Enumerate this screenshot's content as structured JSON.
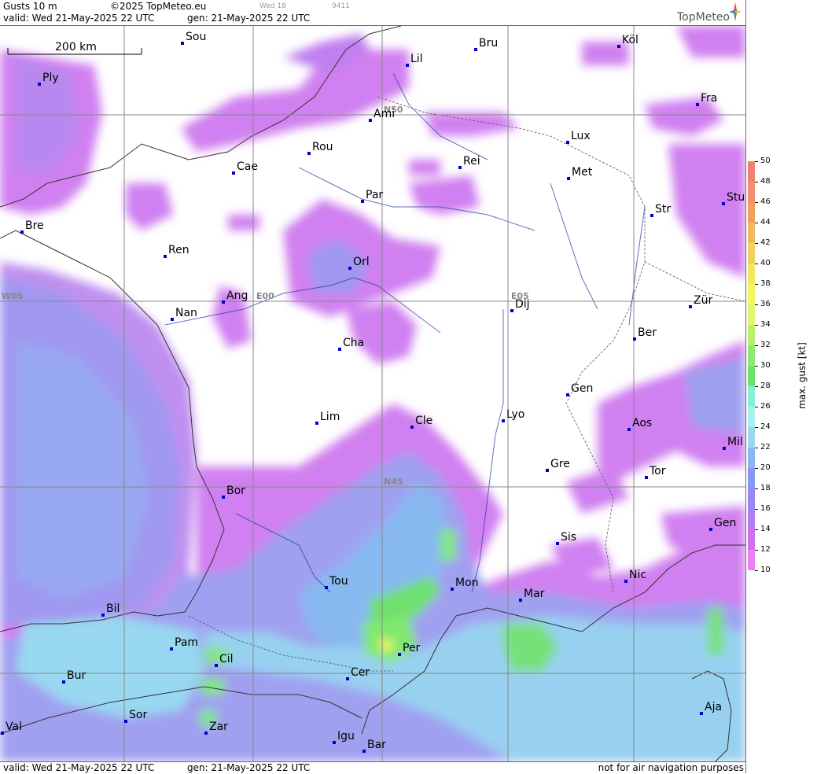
{
  "header": {
    "title": "Gusts 10 m",
    "copyright": "©2025 TopMeteo.eu",
    "valid": "valid:  Wed  21-May-2025  22 UTC",
    "gen": "gen:  21-May-2025  22 UTC",
    "small1": "Wed 18",
    "small2": "9411",
    "logo": "TopMeteo"
  },
  "footer": {
    "valid": "valid:  Wed  21-May-2025  22 UTC",
    "gen": "gen:  21-May-2025  22 UTC",
    "notice": "not for air navigation purposes"
  },
  "scale_bar": "200 km",
  "grid_labels": [
    "N50",
    "N45",
    "W05",
    "E00",
    "E05"
  ],
  "cities": [
    {
      "name": "Sou"
    },
    {
      "name": "Bru"
    },
    {
      "name": "Köl"
    },
    {
      "name": "Ply"
    },
    {
      "name": "Lil"
    },
    {
      "name": "Ami"
    },
    {
      "name": "Fra"
    },
    {
      "name": "Lux"
    },
    {
      "name": "Rou"
    },
    {
      "name": "Cae"
    },
    {
      "name": "Rei"
    },
    {
      "name": "Met"
    },
    {
      "name": "Par"
    },
    {
      "name": "Stu"
    },
    {
      "name": "Bre"
    },
    {
      "name": "Str"
    },
    {
      "name": "Ren"
    },
    {
      "name": "Orl"
    },
    {
      "name": "Ang"
    },
    {
      "name": "Nan"
    },
    {
      "name": "Dij"
    },
    {
      "name": "Zür"
    },
    {
      "name": "Cha"
    },
    {
      "name": "Ber"
    },
    {
      "name": "Gen"
    },
    {
      "name": "Lim"
    },
    {
      "name": "Cle"
    },
    {
      "name": "Lyo"
    },
    {
      "name": "Aos"
    },
    {
      "name": "Mil"
    },
    {
      "name": "Gre"
    },
    {
      "name": "Tor"
    },
    {
      "name": "Bor"
    },
    {
      "name": "Gen"
    },
    {
      "name": "Sis"
    },
    {
      "name": "Tou"
    },
    {
      "name": "Mon"
    },
    {
      "name": "Nic"
    },
    {
      "name": "Mar"
    },
    {
      "name": "Bil"
    },
    {
      "name": "Pam"
    },
    {
      "name": "Cil"
    },
    {
      "name": "Per"
    },
    {
      "name": "Cer"
    },
    {
      "name": "Bur"
    },
    {
      "name": "Sor"
    },
    {
      "name": "Aja"
    },
    {
      "name": "Val"
    },
    {
      "name": "Zar"
    },
    {
      "name": "Igu"
    },
    {
      "name": "Bar"
    }
  ],
  "legend": {
    "title": "max. gust  [kt]",
    "ticks": [
      "50",
      "48",
      "46",
      "44",
      "42",
      "40",
      "38",
      "36",
      "34",
      "32",
      "30",
      "28",
      "26",
      "24",
      "22",
      "20",
      "18",
      "16",
      "14",
      "12",
      "10"
    ],
    "colors": [
      "#f08070",
      "#f09070",
      "#f0a060",
      "#f0b860",
      "#f0d060",
      "#f0e860",
      "#f0f860",
      "#e0f870",
      "#b8f070",
      "#90e870",
      "#70e070",
      "#88f0d0",
      "#a8f0f0",
      "#98d8f0",
      "#88b8f0",
      "#8898f0",
      "#9888f0",
      "#b080f0",
      "#d070f0",
      "#e880f0"
    ]
  }
}
